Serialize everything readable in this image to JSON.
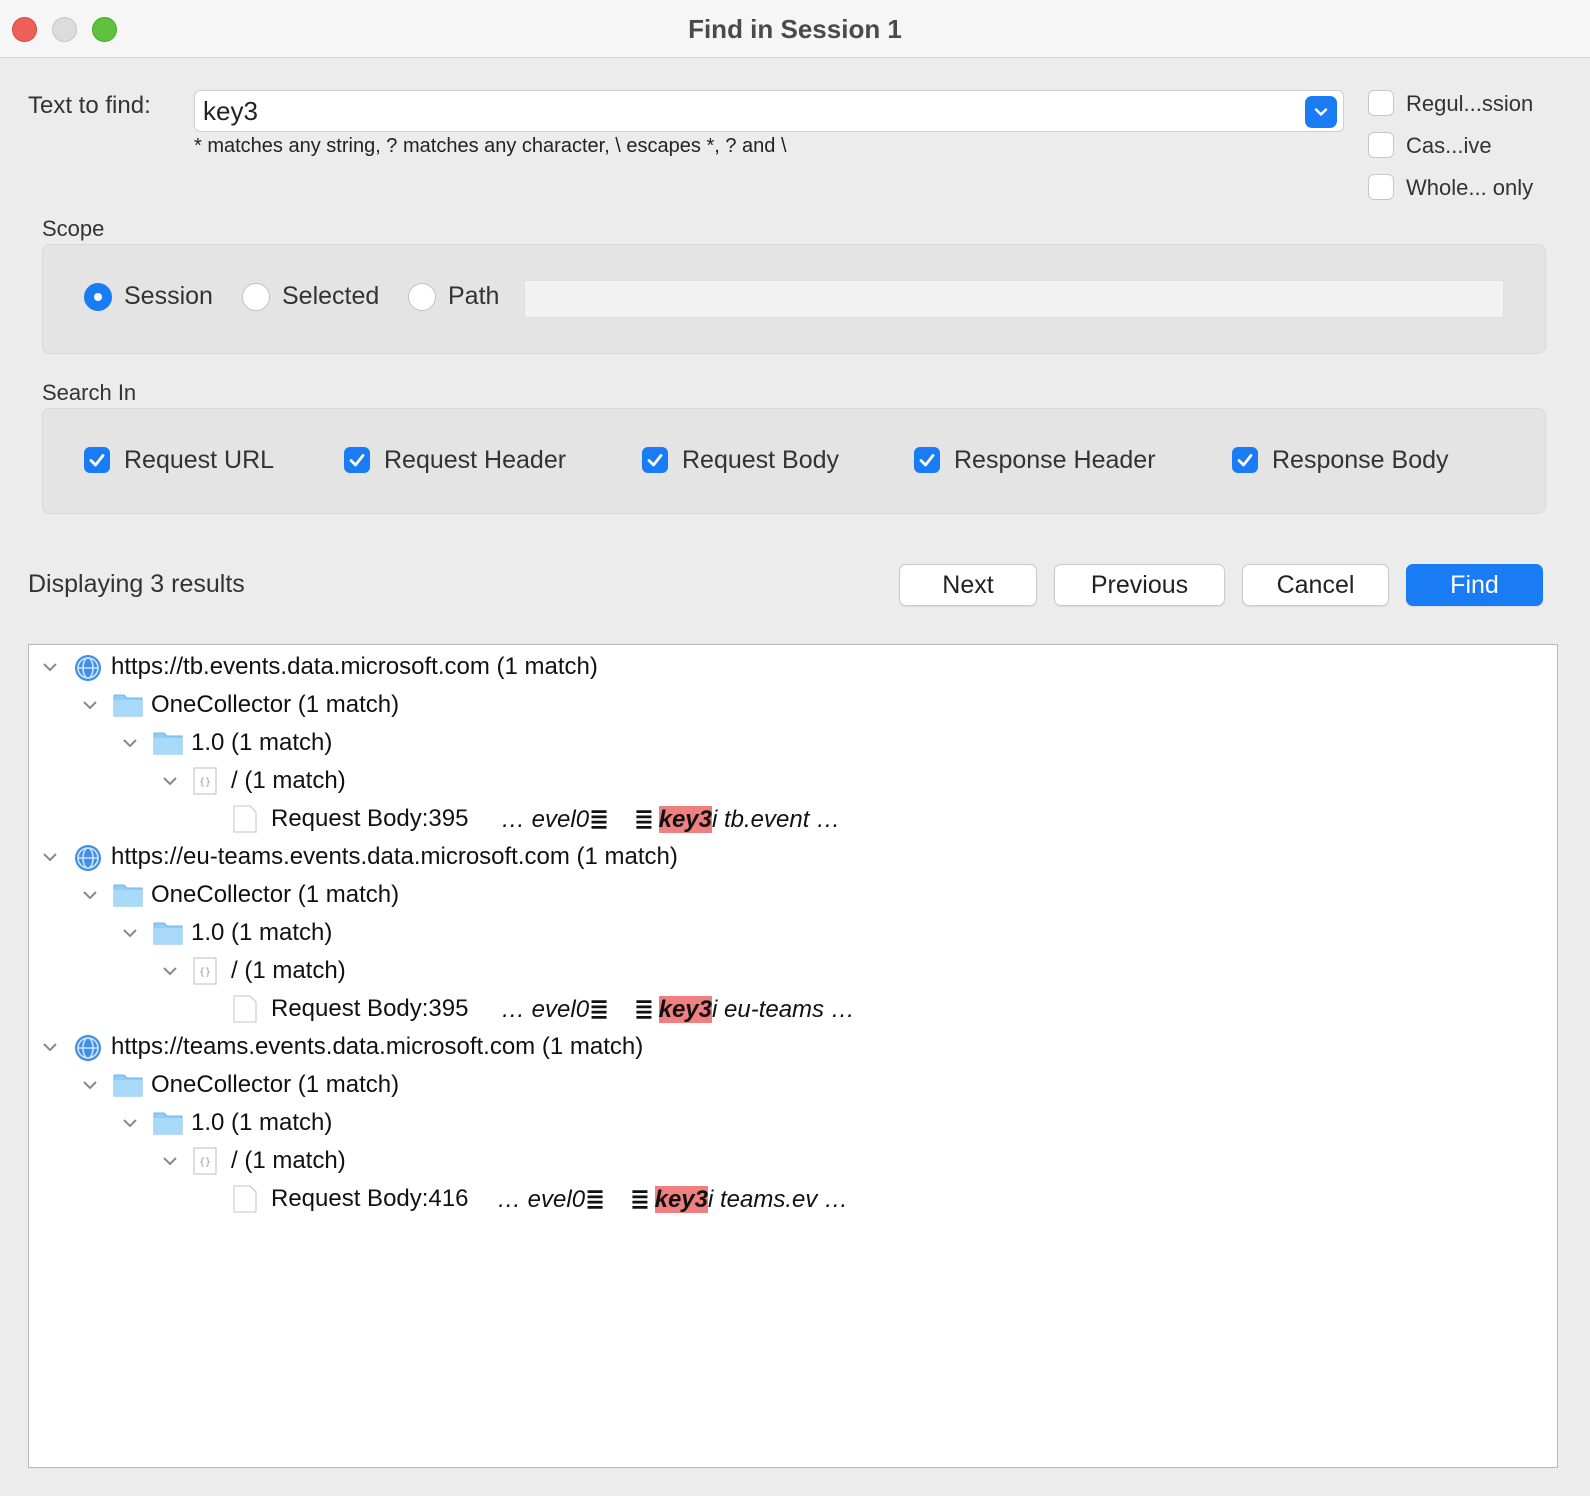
{
  "window": {
    "title": "Find in Session 1"
  },
  "find": {
    "label": "Text to find:",
    "value": "key3",
    "hint": "* matches any string, ? matches any character, \\ escapes *, ? and \\"
  },
  "options": [
    {
      "label": "Regul...ssion",
      "checked": false
    },
    {
      "label": "Cas...ive",
      "checked": false
    },
    {
      "label": "Whole... only",
      "checked": false
    }
  ],
  "scope": {
    "label": "Scope",
    "radios": [
      {
        "label": "Session",
        "selected": true
      },
      {
        "label": "Selected",
        "selected": false
      },
      {
        "label": "Path",
        "selected": false
      }
    ],
    "path_value": ""
  },
  "search_in": {
    "label": "Search In",
    "items": [
      {
        "label": "Request URL",
        "checked": true
      },
      {
        "label": "Request Header",
        "checked": true
      },
      {
        "label": "Request Body",
        "checked": true
      },
      {
        "label": "Response Header",
        "checked": true
      },
      {
        "label": "Response Body",
        "checked": true
      }
    ]
  },
  "status": "Displaying 3 results",
  "buttons": {
    "next": "Next",
    "previous": "Previous",
    "cancel": "Cancel",
    "find": "Find"
  },
  "results": [
    {
      "host": "https://tb.events.data.microsoft.com (1 match)",
      "folder1": "OneCollector (1 match)",
      "folder2": "1.0 (1 match)",
      "path": "/ (1 match)",
      "match_label": "Request Body:395",
      "snip_pre": "… evel0",
      "snip_key": "key3",
      "snip_post": "i tb.event …"
    },
    {
      "host": "https://eu-teams.events.data.microsoft.com (1 match)",
      "folder1": "OneCollector (1 match)",
      "folder2": "1.0 (1 match)",
      "path": "/ (1 match)",
      "match_label": "Request Body:395",
      "snip_pre": "… evel0",
      "snip_key": "key3",
      "snip_post": "i eu-teams …"
    },
    {
      "host": "https://teams.events.data.microsoft.com (1 match)",
      "folder1": "OneCollector (1 match)",
      "folder2": "1.0 (1 match)",
      "path": "/ (1 match)",
      "match_label": "Request Body:416",
      "snip_pre": "… evel0",
      "snip_key": "key3",
      "snip_post": "i teams.ev …"
    }
  ],
  "colors": {
    "accent": "#1a7cf4",
    "highlight": "#f08080"
  }
}
